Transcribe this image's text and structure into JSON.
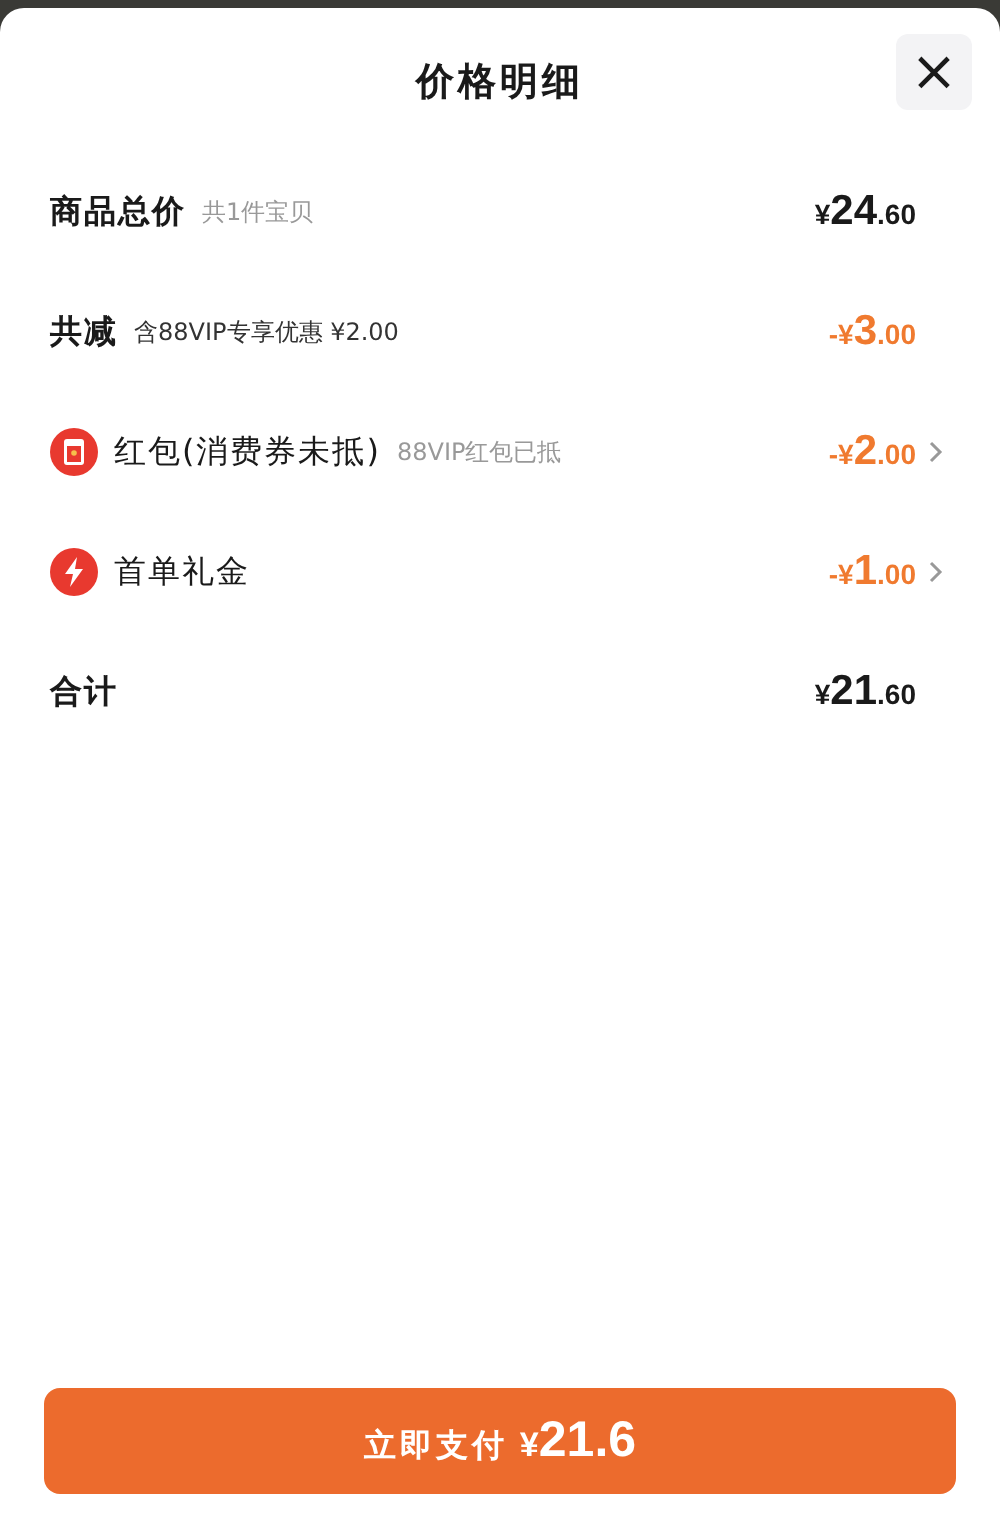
{
  "sheet": {
    "title": "价格明细",
    "close_label": "×"
  },
  "rows": [
    {
      "kind": "plain",
      "label": "商品总价",
      "note": "共1件宝贝",
      "note_dark": false,
      "amount": "¥24.60",
      "discount": false,
      "has_arrow": false
    },
    {
      "kind": "plain",
      "label": "共减",
      "note": "含88VIP专享优惠 ¥2.00",
      "note_dark": true,
      "amount": "-¥3.00",
      "discount": true,
      "has_arrow": false
    },
    {
      "kind": "red-packet",
      "label": "红包(消费券未抵)",
      "note": "88VIP红包已抵",
      "note_dark": false,
      "amount": "-¥2.00",
      "discount": true,
      "has_arrow": true
    },
    {
      "kind": "lightning",
      "label": "首单礼金",
      "amount": "-¥1.00",
      "discount": true,
      "has_arrow": true
    },
    {
      "kind": "total",
      "label": "合计",
      "amount": "¥21.60",
      "discount": false,
      "has_arrow": false
    }
  ],
  "pay_button": {
    "label": "立即支付",
    "amount": "¥21.6"
  }
}
